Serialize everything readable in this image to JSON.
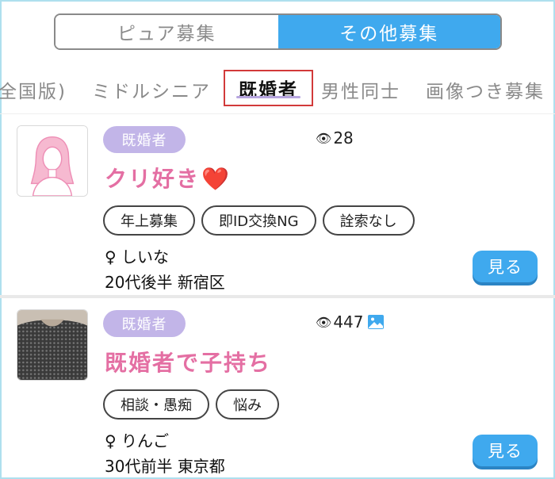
{
  "segment": {
    "options": [
      {
        "label": "ピュア募集",
        "selected": false
      },
      {
        "label": "その他募集",
        "selected": true
      }
    ]
  },
  "tabs": [
    {
      "label": "全国版)"
    },
    {
      "label": "ミドルシニア"
    },
    {
      "label": "既婚者",
      "active": true
    },
    {
      "label": "男性同士"
    },
    {
      "label": "画像つき募集"
    }
  ],
  "posts": [
    {
      "badge": "既婚者",
      "views": "28",
      "has_image": false,
      "title": "クリ好き",
      "title_emoji": "❤️",
      "tags": [
        "年上募集",
        "即ID交換NG",
        "詮索なし"
      ],
      "gender_symbol": "♀",
      "name": "しいな",
      "age": "20代後半",
      "area": "新宿区",
      "button": "見る"
    },
    {
      "badge": "既婚者",
      "views": "447",
      "has_image": true,
      "title": "既婚者で子持ち",
      "tags": [
        "相談・愚痴",
        "悩み"
      ],
      "gender_symbol": "♀",
      "name": "りんご",
      "age": "30代前半",
      "area": "東京都",
      "button": "見る"
    }
  ],
  "colors": {
    "accent": "#3fa9ee",
    "badge": "#c2b5e8",
    "title": "#e46fa3",
    "active_tab_border": "#d23a3a"
  },
  "icons": [
    "eye-icon",
    "image-icon",
    "female-icon",
    "avatar-silhouette-icon"
  ]
}
